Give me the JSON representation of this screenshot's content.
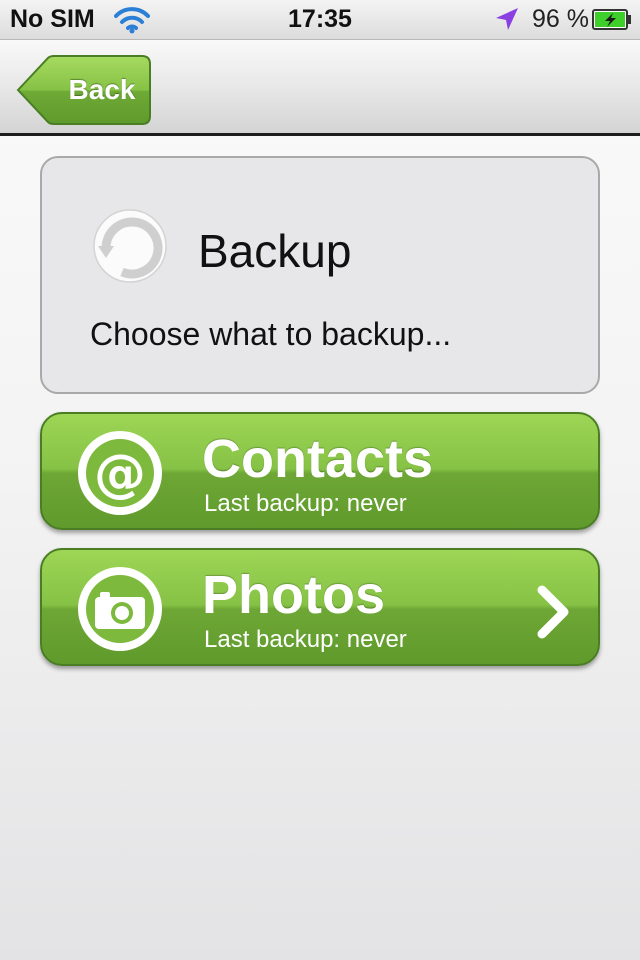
{
  "status_bar": {
    "carrier": "No SIM",
    "time": "17:35",
    "battery_percent": "96 %",
    "wifi_icon": "wifi-icon",
    "location_icon": "location-arrow-icon",
    "battery_icon": "battery-charging-icon",
    "location_color": "#8a3fe0",
    "battery_color": "#3fcf2a"
  },
  "nav": {
    "back_label": "Back",
    "back_color": "#7dbb3e"
  },
  "info": {
    "icon": "backup-refresh-icon",
    "title": "Backup",
    "subtitle": "Choose what to backup..."
  },
  "actions": [
    {
      "icon": "at-sign-icon",
      "title": "Contacts",
      "subtitle": "Last backup: never"
    },
    {
      "icon": "camera-icon",
      "title": "Photos",
      "subtitle": "Last backup: never",
      "chevron": "chevron-right-icon"
    }
  ],
  "colors": {
    "button_green": "#86c245",
    "button_border": "#4a7e24"
  }
}
